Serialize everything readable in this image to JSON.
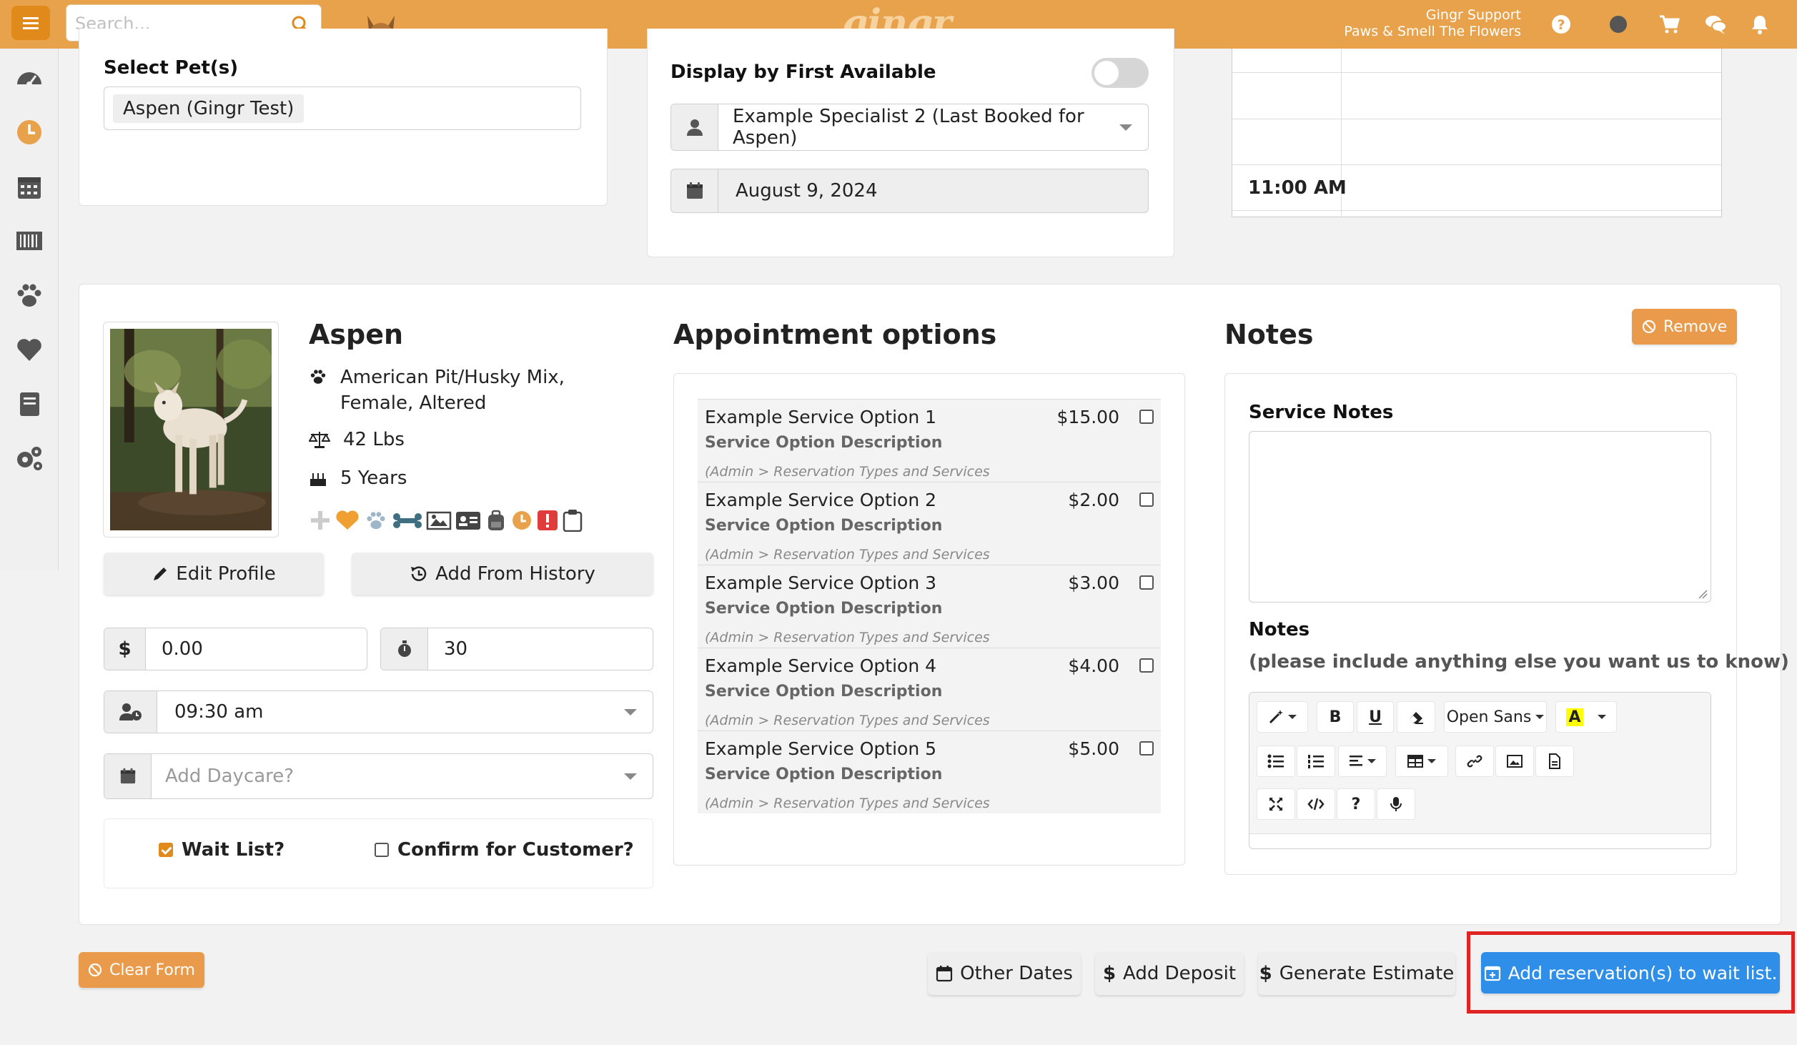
{
  "topbar": {
    "search_placeholder": "Search...",
    "logo": "gingr",
    "user_name": "Gingr Support",
    "location": "Paws & Smell The Flowers"
  },
  "sidebar": {
    "items": [
      "dashboard",
      "clock",
      "calendar",
      "barcode",
      "paw",
      "heart",
      "book",
      "settings"
    ]
  },
  "select_pets": {
    "label": "Select Pet(s)",
    "selected": "Aspen (Gingr Test)"
  },
  "specialist": {
    "label": "Display by First Available",
    "value": "Example Specialist 2 (Last Booked for Aspen)",
    "date": "August 9, 2024"
  },
  "timegrid": {
    "time_label": "11:00 AM"
  },
  "pet": {
    "name": "Aspen",
    "breed": "American Pit/Husky Mix, Female, Altered",
    "weight": "42 Lbs",
    "age": "5 Years",
    "edit_profile": "Edit Profile",
    "add_from_history": "Add From History",
    "price": "0.00",
    "duration": "30",
    "time": "09:30 am",
    "daycare_placeholder": "Add Daycare?",
    "wait_list": "Wait List?",
    "confirm_customer": "Confirm for Customer?"
  },
  "appointment": {
    "title": "Appointment options",
    "options": [
      {
        "name": "Example Service Option 1",
        "description": "Service Option Description",
        "price": "$15.00",
        "admin_note": "(Admin > Reservation Types and Services"
      },
      {
        "name": "Example Service Option 2",
        "description": "Service Option Description",
        "price": "$2.00",
        "admin_note": "(Admin > Reservation Types and Services"
      },
      {
        "name": "Example Service Option 3",
        "description": "Service Option Description",
        "price": "$3.00",
        "admin_note": "(Admin > Reservation Types and Services"
      },
      {
        "name": "Example Service Option 4",
        "description": "Service Option Description",
        "price": "$4.00",
        "admin_note": "(Admin > Reservation Types and Services"
      },
      {
        "name": "Example Service Option 5",
        "description": "Service Option Description",
        "price": "$5.00",
        "admin_note": "(Admin > Reservation Types and Services"
      }
    ]
  },
  "notes": {
    "title": "Notes",
    "remove": "Remove",
    "service_notes_label": "Service Notes",
    "notes_label": "Notes",
    "notes_hint": "(please include anything else you want us to know)",
    "font": "Open Sans"
  },
  "footer": {
    "clear_form": "Clear Form",
    "other_dates": "Other Dates",
    "add_deposit": "Add Deposit",
    "generate_estimate": "Generate Estimate",
    "add_waitlist": "Add reservation(s) to wait list."
  },
  "colors": {
    "brand": "#e9a24c",
    "primary": "#2f8ee8",
    "highlight": "#e02323"
  }
}
